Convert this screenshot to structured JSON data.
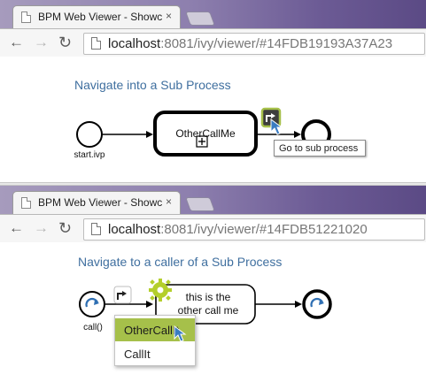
{
  "panels": [
    {
      "tab_title": "BPM Web Viewer - Showc",
      "tab_close": "×",
      "url_host": "localhost",
      "url_path": ":8081/ivy/viewer/#14FDB19193A37A23",
      "heading": "Navigate into a Sub Process",
      "start_label": "start.ivp",
      "subprocess_label": "OtherCallMe",
      "tooltip": "Go to sub process"
    },
    {
      "tab_title": "BPM Web Viewer - Showc",
      "tab_close": "×",
      "url_host": "localhost",
      "url_path": ":8081/ivy/viewer/#14FDB51221020",
      "heading": "Navigate to a caller of a Sub Process",
      "start_label": "call()",
      "task_label_line1": "this is the",
      "task_label_line2": "other call me",
      "menu_items": [
        "OtherCallIt",
        "CallIt"
      ]
    }
  ],
  "nav": {
    "back": "←",
    "forward": "→",
    "reload": "↻"
  },
  "colors": {
    "heading": "#3f6f9f",
    "accent_green": "#a6c04a",
    "event_blue": "#2f6fb3",
    "cursor_blue": "#3a7cc2"
  },
  "icons": [
    "page-icon",
    "back-arrow-icon",
    "forward-arrow-icon",
    "reload-icon",
    "go-to-subprocess-icon",
    "jump-to-caller-icon",
    "gear-icon",
    "cursor-pointer-icon",
    "loop-icon"
  ]
}
